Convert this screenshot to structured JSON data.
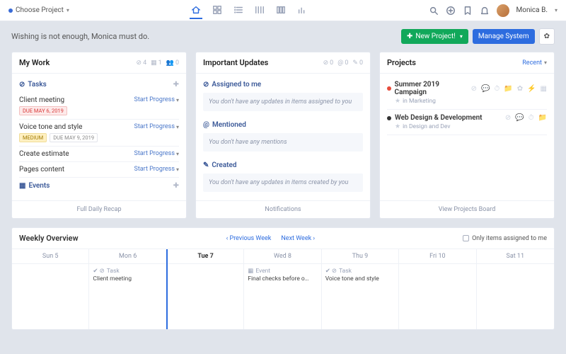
{
  "header": {
    "project_picker": "Choose Project",
    "user_name": "Monica B."
  },
  "slogan": "Wishing is not enough, Monica must do.",
  "buttons": {
    "new_project": "New Project!",
    "manage_system": "Manage System"
  },
  "mywork": {
    "title": "My Work",
    "meta": {
      "done": "4",
      "calendar": "1",
      "people": "0"
    },
    "tasks_label": "Tasks",
    "events_label": "Events",
    "start_progress": "Start Progress",
    "footer": "Full Daily Recap",
    "tasks": [
      {
        "name": "Client meeting",
        "tags": [
          {
            "kind": "red",
            "text": "DUE MAY 6, 2019"
          }
        ]
      },
      {
        "name": "Voice tone and style",
        "tags": [
          {
            "kind": "yellow",
            "text": "MEDIUM"
          },
          {
            "kind": "grey",
            "text": "DUE MAY 9, 2019"
          }
        ]
      },
      {
        "name": "Create estimate",
        "tags": []
      },
      {
        "name": "Pages content",
        "tags": []
      }
    ]
  },
  "updates": {
    "title": "Important Updates",
    "meta": {
      "done": "0",
      "at": "0",
      "pin": "0"
    },
    "footer": "Notifications",
    "sections": [
      {
        "label": "Assigned to me",
        "empty": "You don't have any updates in items assigned to you"
      },
      {
        "label": "Mentioned",
        "empty": "You don't have any mentions"
      },
      {
        "label": "Created",
        "empty": "You don't have any updates in items created by you"
      }
    ]
  },
  "projects": {
    "title": "Projects",
    "recent_label": "Recent",
    "footer": "View Projects Board",
    "items": [
      {
        "color": "#e74c3c",
        "name": "Summer 2019 Campaign",
        "sub": "in Marketing"
      },
      {
        "color": "#333",
        "name": "Web Design & Development",
        "sub": "in Design and Dev"
      }
    ]
  },
  "weekly": {
    "title": "Weekly Overview",
    "prev": "Previous Week",
    "next": "Next Week",
    "only_mine": "Only items assigned to me",
    "days": [
      {
        "label": "Sun 5",
        "today": false,
        "items": []
      },
      {
        "label": "Mon 6",
        "today": false,
        "items": [
          {
            "kind": "Task",
            "text": "Client meeting",
            "icon": "check"
          }
        ]
      },
      {
        "label": "Tue 7",
        "today": true,
        "items": []
      },
      {
        "label": "Wed 8",
        "today": false,
        "items": [
          {
            "kind": "Event",
            "text": "Final checks before o…",
            "icon": "cal"
          }
        ]
      },
      {
        "label": "Thu 9",
        "today": false,
        "items": [
          {
            "kind": "Task",
            "text": "Voice tone and style",
            "icon": "check"
          }
        ]
      },
      {
        "label": "Fri 10",
        "today": false,
        "items": []
      },
      {
        "label": "Sat 11",
        "today": false,
        "items": []
      }
    ]
  }
}
